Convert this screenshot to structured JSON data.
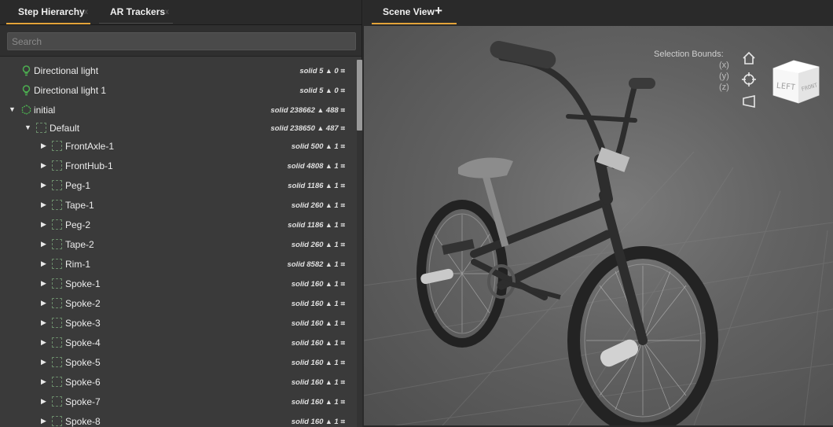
{
  "left_tabs": [
    {
      "label": "Step Hierarchy",
      "close": "x"
    },
    {
      "label": "AR Trackers",
      "close": "x"
    }
  ],
  "search": {
    "placeholder": "Search"
  },
  "tree": [
    {
      "label": "Directional light",
      "stats_prefix": "solid 5",
      "stats_suffix": "0"
    },
    {
      "label": "Directional light 1",
      "stats_prefix": "solid 5",
      "stats_suffix": "0"
    },
    {
      "label": "initial",
      "stats_prefix": "solid 238662",
      "stats_suffix": "488"
    },
    {
      "label": "Default",
      "stats_prefix": "solid 238650",
      "stats_suffix": "487"
    },
    {
      "label": "FrontAxle-1",
      "stats_prefix": "solid 500",
      "stats_suffix": "1"
    },
    {
      "label": "FrontHub-1",
      "stats_prefix": "solid 4808",
      "stats_suffix": "1"
    },
    {
      "label": "Peg-1",
      "stats_prefix": "solid 1186",
      "stats_suffix": "1"
    },
    {
      "label": "Tape-1",
      "stats_prefix": "solid 260",
      "stats_suffix": "1"
    },
    {
      "label": "Peg-2",
      "stats_prefix": "solid 1186",
      "stats_suffix": "1"
    },
    {
      "label": "Tape-2",
      "stats_prefix": "solid 260",
      "stats_suffix": "1"
    },
    {
      "label": "Rim-1",
      "stats_prefix": "solid 8582",
      "stats_suffix": "1"
    },
    {
      "label": "Spoke-1",
      "stats_prefix": "solid 160",
      "stats_suffix": "1"
    },
    {
      "label": "Spoke-2",
      "stats_prefix": "solid 160",
      "stats_suffix": "1"
    },
    {
      "label": "Spoke-3",
      "stats_prefix": "solid 160",
      "stats_suffix": "1"
    },
    {
      "label": "Spoke-4",
      "stats_prefix": "solid 160",
      "stats_suffix": "1"
    },
    {
      "label": "Spoke-5",
      "stats_prefix": "solid 160",
      "stats_suffix": "1"
    },
    {
      "label": "Spoke-6",
      "stats_prefix": "solid 160",
      "stats_suffix": "1"
    },
    {
      "label": "Spoke-7",
      "stats_prefix": "solid 160",
      "stats_suffix": "1"
    },
    {
      "label": "Spoke-8",
      "stats_prefix": "solid 160",
      "stats_suffix": "1"
    }
  ],
  "scene": {
    "tab_label": "Scene View",
    "add_label": "+",
    "bounds_title": "Selection Bounds:",
    "axis_x": "(x)",
    "axis_y": "(y)",
    "axis_z": "(z)",
    "cube_left": "LEFT",
    "cube_front": "FRONT"
  },
  "colors": {
    "accent": "#e3a33a",
    "light_icon": "#4caf50",
    "panel": "#3a3a3a"
  }
}
